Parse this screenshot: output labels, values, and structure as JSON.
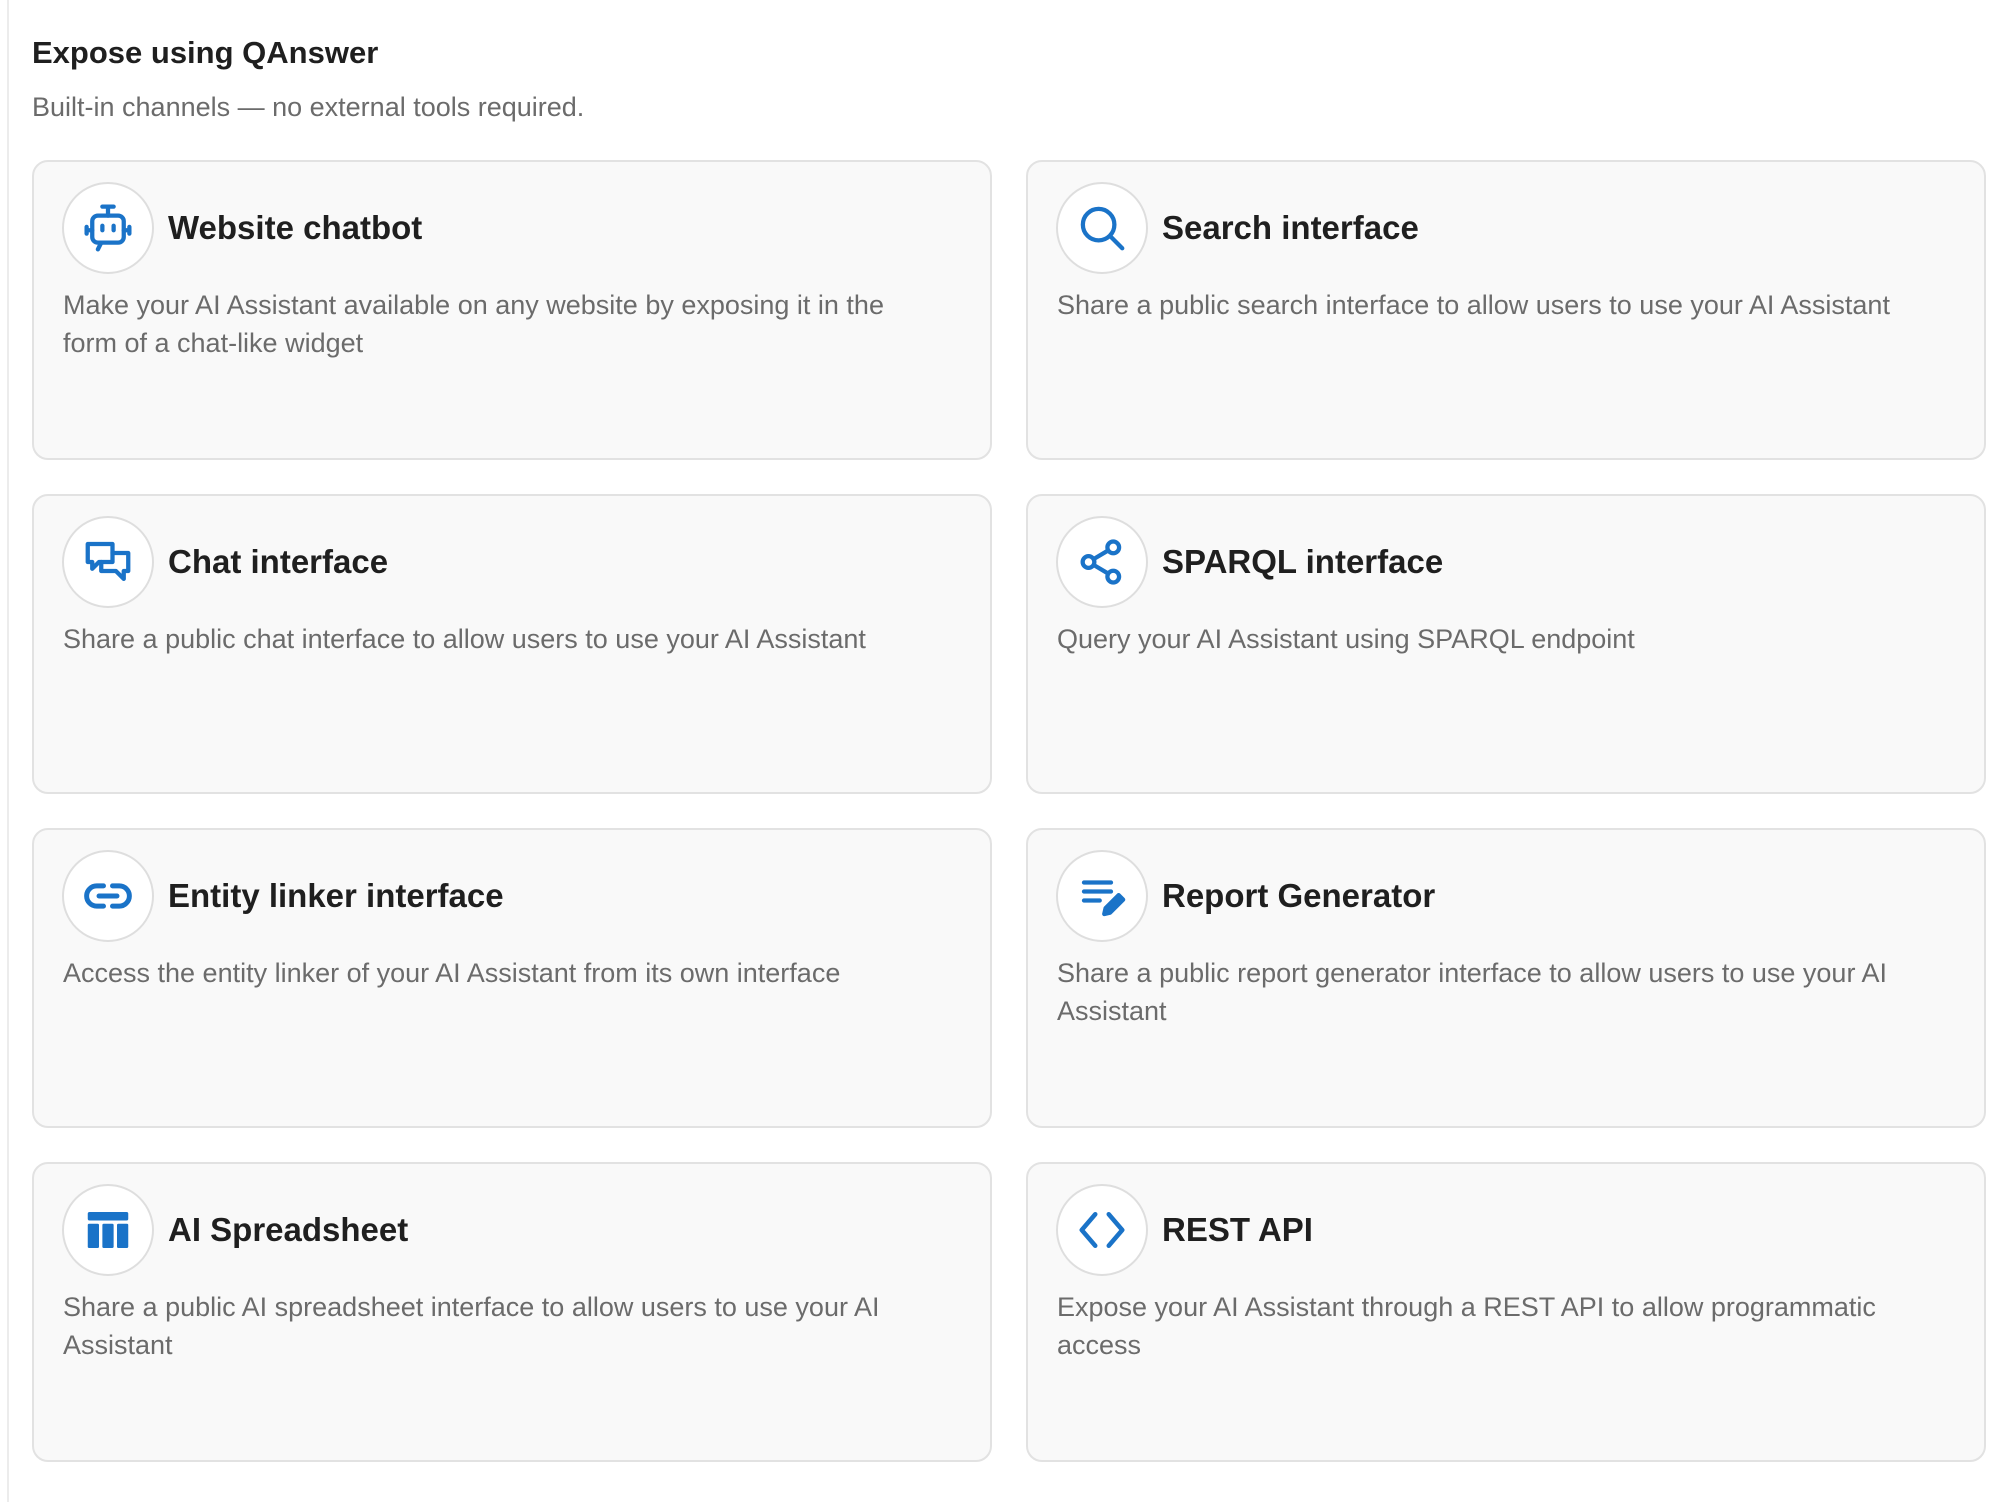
{
  "section": {
    "title": "Expose using QAnswer",
    "subtitle": "Built-in channels — no external tools required."
  },
  "theme": {
    "accent": "#1a73c8",
    "card_background": "#f9f9f9",
    "card_border": "#e2e2e2"
  },
  "channels": [
    {
      "icon": "robot-icon",
      "title": "Website chatbot",
      "description": "Make your AI Assistant available on any website by exposing it in the form of a chat-like widget"
    },
    {
      "icon": "search-icon",
      "title": "Search interface",
      "description": "Share a public search interface to allow users to use your AI Assistant"
    },
    {
      "icon": "chat-bubbles-icon",
      "title": "Chat interface",
      "description": "Share a public chat interface to allow users to use your AI Assistant"
    },
    {
      "icon": "share-nodes-icon",
      "title": "SPARQL interface",
      "description": "Query your AI Assistant using SPARQL endpoint"
    },
    {
      "icon": "link-icon",
      "title": "Entity linker interface",
      "description": "Access the entity linker of your AI Assistant from its own interface"
    },
    {
      "icon": "edit-notes-icon",
      "title": "Report Generator",
      "description": "Share a public report generator interface to allow users to use your AI Assistant"
    },
    {
      "icon": "table-icon",
      "title": "AI Spreadsheet",
      "description": "Share a public AI spreadsheet interface to allow users to use your AI Assistant"
    },
    {
      "icon": "code-brackets-icon",
      "title": "REST API",
      "description": "Expose your AI Assistant through a REST API to allow programmatic access"
    }
  ]
}
